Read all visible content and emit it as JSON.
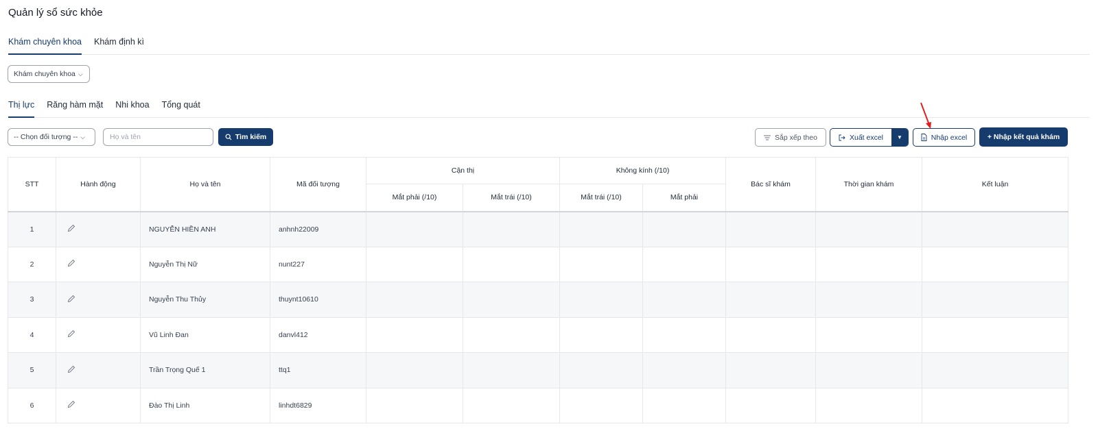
{
  "page": {
    "title": "Quản lý sổ sức khỏe"
  },
  "tabs": [
    {
      "label": "Khám chuyên khoa",
      "active": true
    },
    {
      "label": "Khám định kì",
      "active": false
    }
  ],
  "specialty_select": {
    "value": "Khám chuyên khoa"
  },
  "subtabs": [
    {
      "label": "Thị lực",
      "active": true
    },
    {
      "label": "Răng hàm mặt",
      "active": false
    },
    {
      "label": "Nhi khoa",
      "active": false
    },
    {
      "label": "Tổng quát",
      "active": false
    }
  ],
  "filters": {
    "subject_select": "-- Chọn đối tượng --",
    "name_placeholder": "Họ và tên",
    "search_label": "Tìm kiếm"
  },
  "toolbar": {
    "sort_label": "Sắp xếp theo",
    "export_label": "Xuất excel",
    "import_label": "Nhập excel",
    "add_result_label": "+ Nhập kết quả khám"
  },
  "table": {
    "headers": {
      "stt": "STT",
      "action": "Hành động",
      "name": "Họ và tên",
      "code": "Mã đối tượng",
      "myopia_group": "Cận thị",
      "myopia_right": "Mắt phải (/10)",
      "myopia_left": "Mắt trái (/10)",
      "noglass_group": "Không kính (/10)",
      "noglass_left": "Mắt trái (/10)",
      "noglass_right": "Mắt phải",
      "doctor": "Bác sĩ khám",
      "time": "Thời gian khám",
      "conclusion": "Kết luận"
    },
    "rows": [
      {
        "stt": "1",
        "name": "NGUYỄN HIỀN ANH",
        "code": "anhnh22009"
      },
      {
        "stt": "2",
        "name": "Nguyễn Thị Nữ",
        "code": "nunt227"
      },
      {
        "stt": "3",
        "name": "Nguyễn Thu Thủy",
        "code": "thuynt10610"
      },
      {
        "stt": "4",
        "name": "Vũ Linh Đan",
        "code": "danvl412"
      },
      {
        "stt": "5",
        "name": "Trần Trọng Quế 1",
        "code": "ttq1"
      },
      {
        "stt": "6",
        "name": "Đào Thị Linh",
        "code": "linhdt6829"
      }
    ]
  },
  "colors": {
    "primary": "#163b6d",
    "annotation_arrow": "#e11d1d"
  }
}
